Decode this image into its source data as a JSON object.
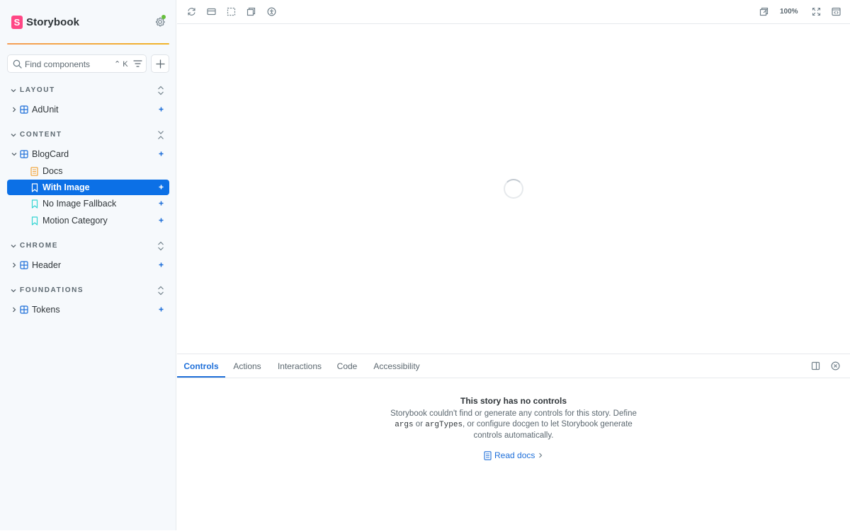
{
  "brand": {
    "logo_letter": "S",
    "name": "Storybook",
    "accent": "#ff4785"
  },
  "search": {
    "placeholder": "Find components",
    "shortcut": "⌃ K"
  },
  "sidebar": {
    "groups": [
      {
        "label": "LAYOUT",
        "items": [
          {
            "label": "AdUnit"
          }
        ]
      },
      {
        "label": "CONTENT",
        "items": [
          {
            "label": "BlogCard",
            "children": [
              {
                "label": "Docs",
                "type": "docs"
              },
              {
                "label": "With Image",
                "type": "story",
                "selected": true
              },
              {
                "label": "No Image Fallback",
                "type": "story"
              },
              {
                "label": "Motion Category",
                "type": "story"
              }
            ]
          }
        ]
      },
      {
        "label": "CHROME",
        "items": [
          {
            "label": "Header"
          }
        ]
      },
      {
        "label": "FOUNDATIONS",
        "items": [
          {
            "label": "Tokens"
          }
        ]
      }
    ]
  },
  "toolbar": {
    "left_icons": [
      "reload-icon",
      "grid-icon",
      "outline-icon",
      "background-icon",
      "accessibility-icon"
    ],
    "zoom": "100%",
    "right_icons": [
      "open-new-tab-icon",
      "fullscreen-icon",
      "share-icon"
    ]
  },
  "addons": {
    "tabs": [
      {
        "label": "Controls",
        "active": true
      },
      {
        "label": "Actions"
      },
      {
        "label": "Interactions"
      },
      {
        "label": "Code"
      },
      {
        "label": "Accessibility"
      }
    ],
    "empty": {
      "title": "This story has no controls",
      "desc_before": "Storybook couldn't find or generate any controls for this story. Define",
      "code1": "args",
      "or": "or",
      "code2": "argTypes",
      "desc_after": ", or configure docgen to let Storybook generate controls automatically.",
      "link": "Read docs"
    }
  },
  "colors": {
    "selected": "#0c70e6",
    "link": "#1e6fd9",
    "sidebar_bg": "#f6f9fc"
  }
}
